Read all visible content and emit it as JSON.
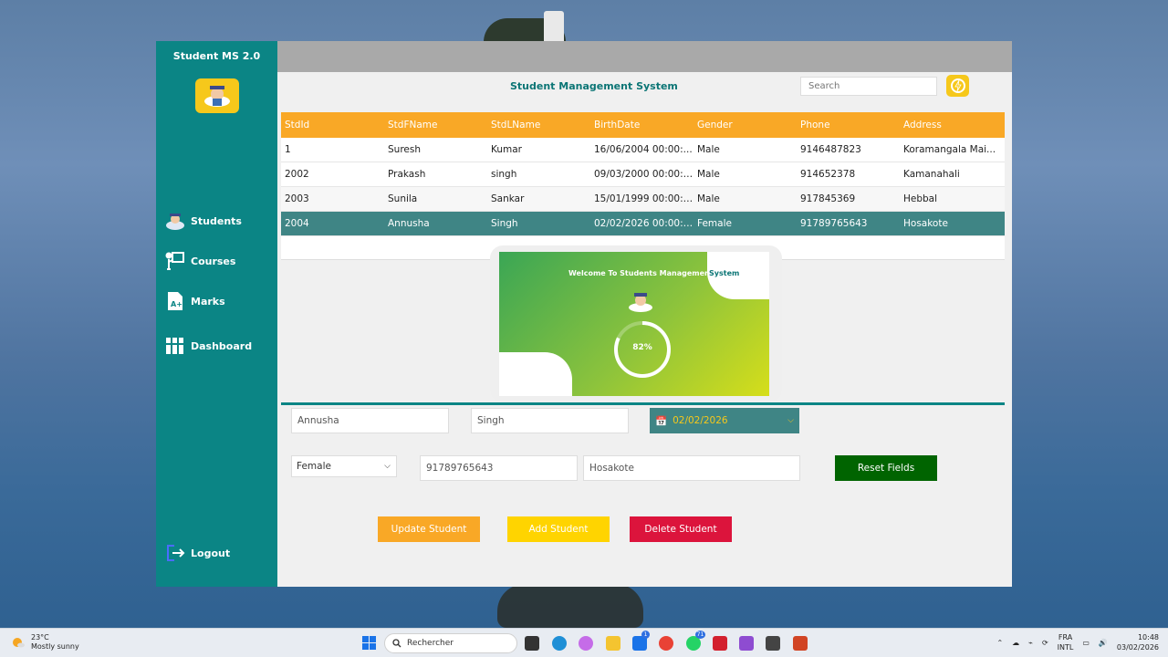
{
  "app": {
    "title": "Student MS 2.0",
    "main_title": "Student Management System",
    "search_placeholder": "Search"
  },
  "sidebar": {
    "items": [
      {
        "label": "Students",
        "icon": "student-icon"
      },
      {
        "label": "Courses",
        "icon": "teacher-board-icon"
      },
      {
        "label": "Marks",
        "icon": "grade-icon"
      },
      {
        "label": "Dashboard",
        "icon": "books-icon"
      }
    ],
    "logout": "Logout"
  },
  "grid": {
    "columns": [
      "StdId",
      "StdFName",
      "StdLName",
      "BirthDate",
      "Gender",
      "Phone",
      "Address"
    ],
    "rows": [
      [
        "1",
        "Suresh",
        "Kumar",
        "16/06/2004 00:00:...",
        "Male",
        "9146487823",
        "Koramangala Mai..."
      ],
      [
        "2002",
        "Prakash",
        "singh",
        "09/03/2000 00:00:00",
        "Male",
        "914652378",
        "Kamanahali"
      ],
      [
        "2003",
        "Sunila",
        "Sankar",
        "15/01/1999 00:00:00",
        "Male",
        "917845369",
        "Hebbal"
      ],
      [
        "2004",
        "Annusha",
        "Singh",
        "02/02/2026 00:00:00",
        "Female",
        "91789765643",
        "Hosakote"
      ]
    ],
    "selected_row": 3
  },
  "splash": {
    "welcome": "Welcome To Students Management",
    "system": "System",
    "progress_label": "82%",
    "progress": 0.82
  },
  "form": {
    "first_name": "Annusha",
    "last_name": "Singh",
    "birth_date": "02/02/2026",
    "gender": "Female",
    "phone": "91789765643",
    "address": "Hosakote",
    "reset_label": "Reset Fields",
    "update_label": "Update Student",
    "add_label": "Add Student",
    "delete_label": "Delete Student"
  },
  "colors": {
    "sidebar": "#0b8585",
    "header": "#f9a826",
    "update": "#f9a826",
    "add": "#ffd400",
    "delete": "#dc143c",
    "reset": "#006400"
  },
  "taskbar": {
    "temp": "23°C",
    "weather": "Mostly sunny",
    "search": "Rechercher",
    "lang1": "FRA",
    "lang2": "INTL",
    "time": "10:48",
    "date": "03/02/2026",
    "badge_store": "1",
    "badge_whatsapp": "71"
  }
}
